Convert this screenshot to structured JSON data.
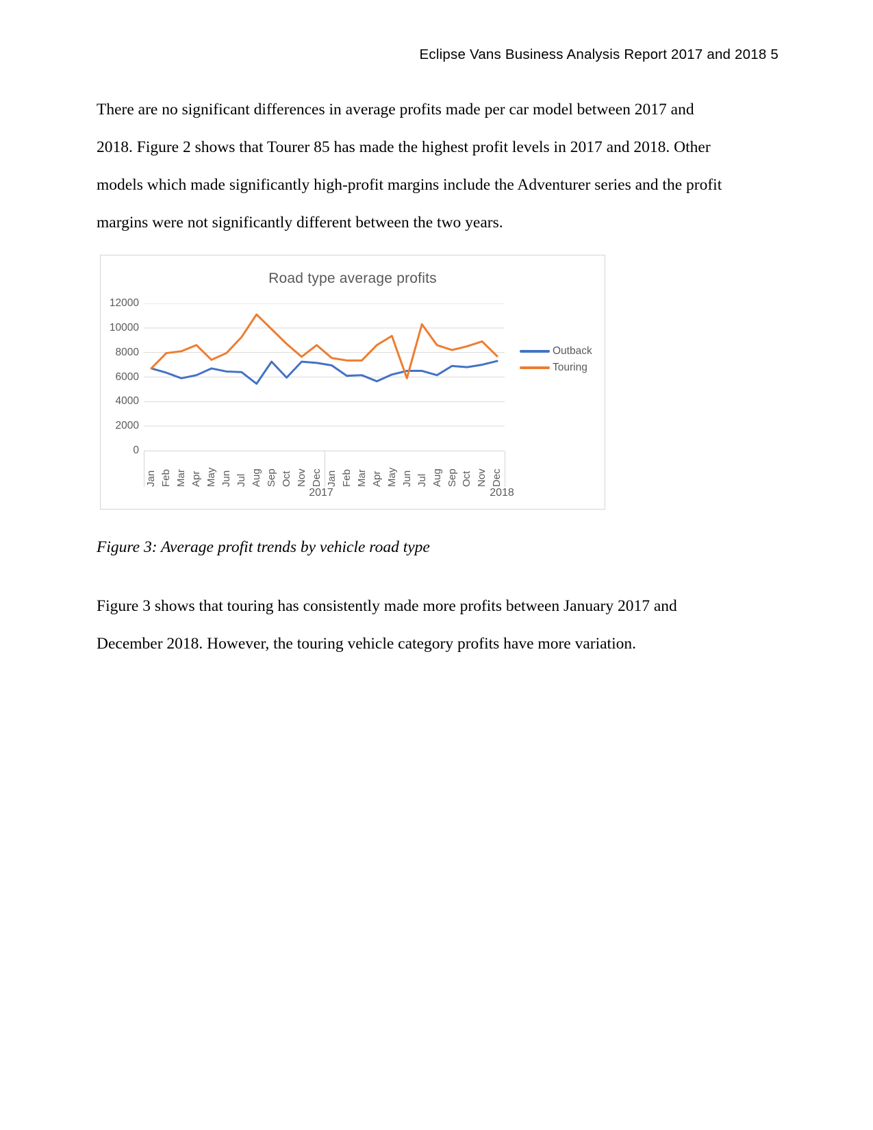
{
  "header": {
    "text": "Eclipse Vans Business Analysis Report 2017 and 2018 5"
  },
  "paragraphs": {
    "p1": "There are no significant differences in average profits made per car model between 2017 and 2018. Figure 2 shows that Tourer 85 has made the highest profit levels in 2017 and 2018. Other models which made significantly high-profit margins include the Adventurer series and the profit margins were not significantly different between the two years.",
    "p2": "Figure 3 shows that touring has consistently made more profits between January 2017 and December 2018. However, the touring vehicle category profits have more variation."
  },
  "caption": "Figure 3: Average profit trends by vehicle road type",
  "colors": {
    "outback": "#4472C4",
    "touring": "#ED7D31",
    "grid": "#D9D9D9",
    "axis_text": "#5A5A5A",
    "title_text": "#595959",
    "frame": "#D4D4D4"
  },
  "chart_data": {
    "type": "line",
    "title": "Road type average profits",
    "xlabel": "",
    "ylabel": "",
    "ylim": [
      0,
      12000
    ],
    "yticks": [
      0,
      2000,
      4000,
      6000,
      8000,
      10000,
      12000
    ],
    "ytick_labels": [
      "0",
      "2000",
      "4000",
      "6000",
      "8000",
      "10000",
      "12000"
    ],
    "grid": true,
    "legend_position": "right",
    "group_labels": [
      "2017",
      "2018"
    ],
    "categories": [
      "Jan",
      "Feb",
      "Mar",
      "Apr",
      "May",
      "Jun",
      "Jul",
      "Aug",
      "Sep",
      "Oct",
      "Nov",
      "Dec",
      "Jan",
      "Feb",
      "Mar",
      "Apr",
      "May",
      "Jun",
      "Jul",
      "Aug",
      "Sep",
      "Oct",
      "Nov",
      "Dec"
    ],
    "series": [
      {
        "name": "Outback",
        "color": "#4472C4",
        "values": [
          6700,
          6350,
          5900,
          6150,
          6700,
          6450,
          6400,
          5450,
          7250,
          5950,
          7250,
          7150,
          6950,
          6100,
          6150,
          5650,
          6200,
          6500,
          6500,
          6150,
          6900,
          6800,
          7000,
          7300
        ]
      },
      {
        "name": "Touring",
        "color": "#ED7D31",
        "values": [
          6700,
          7950,
          8100,
          8600,
          7400,
          7950,
          9250,
          11100,
          9900,
          8700,
          7650,
          8600,
          7550,
          7350,
          7350,
          8600,
          9350,
          5900,
          10300,
          8600,
          8200,
          8500,
          8900,
          7700
        ]
      }
    ]
  },
  "legend": [
    {
      "label": "Outback",
      "color": "#4472C4"
    },
    {
      "label": "Touring",
      "color": "#ED7D31"
    }
  ]
}
